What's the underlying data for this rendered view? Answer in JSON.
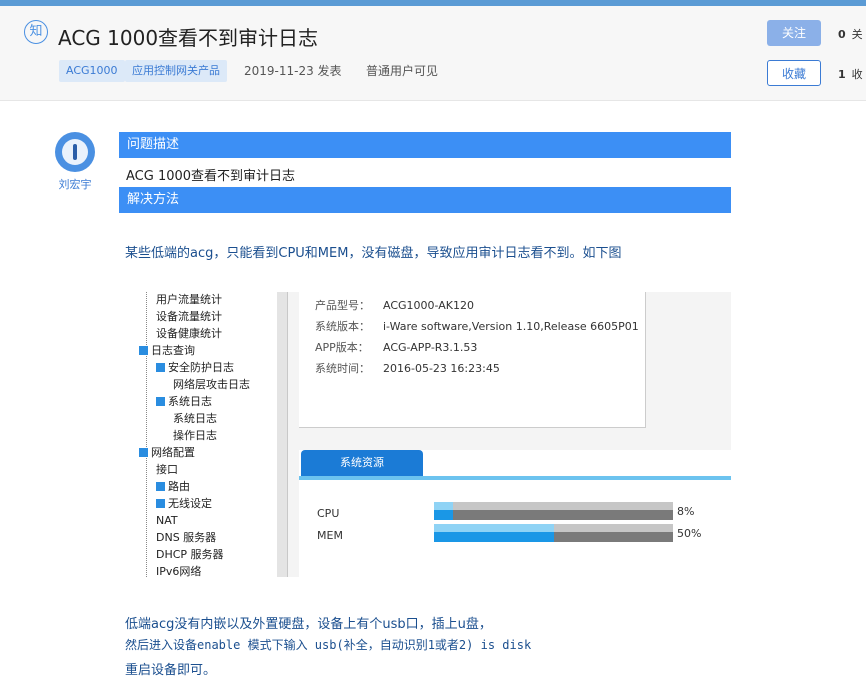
{
  "header": {
    "badge": "知",
    "title": "ACG 1000查看不到审计日志",
    "tags": [
      "ACG1000",
      "应用控制网关产品"
    ],
    "date": "2019-11-23 发表",
    "visibility": "普通用户可见",
    "follow_label": "关注",
    "favorite_label": "收藏",
    "follow_count": "0",
    "follow_count_label": "关",
    "favorite_count": "1",
    "favorite_count_label": "收"
  },
  "author": {
    "name": "刘宏宇"
  },
  "sections": {
    "problem_title": "问题描述",
    "problem_text": "ACG 1000查看不到审计日志",
    "solution_title": "解决方法"
  },
  "body": {
    "para1": "某些低端的acg，只能看到CPU和MEM，没有磁盘，导致应用审计日志看不到。如下图",
    "para2": "低端acg没有内嵌以及外置硬盘，设备上有个usb口，插上u盘，",
    "para3": "然后进入设备enable  模式下输入  usb(补全，自动识别1或者2) is disk",
    "para4": "重启设备即可。"
  },
  "screenshot": {
    "tree_items": [
      "用户流量统计",
      "设备流量统计",
      "设备健康统计",
      "日志查询",
      "安全防护日志",
      "网络层攻击日志",
      "系统日志",
      "系统日志",
      "操作日志",
      "网络配置",
      "接口",
      "路由",
      "无线设定",
      "NAT",
      "DNS 服务器",
      "DHCP 服务器",
      "IPv6网络"
    ],
    "info": [
      {
        "key": "产品型号：",
        "value": "ACG1000-AK120"
      },
      {
        "key": "系统版本：",
        "value": "i-Ware software,Version 1.10,Release 6605P01"
      },
      {
        "key": "APP版本：",
        "value": "ACG-APP-R3.1.53"
      },
      {
        "key": "系统时间：",
        "value": "2016-05-23 16:23:45"
      }
    ],
    "panel_tab": "系统资源",
    "resources": [
      {
        "label": "CPU",
        "percent_text": "8%",
        "percent": 8
      },
      {
        "label": "MEM",
        "percent_text": "50%",
        "percent": 50
      }
    ]
  },
  "colors": {
    "accent": "#3c8ff5",
    "link": "#3b7bd4"
  }
}
